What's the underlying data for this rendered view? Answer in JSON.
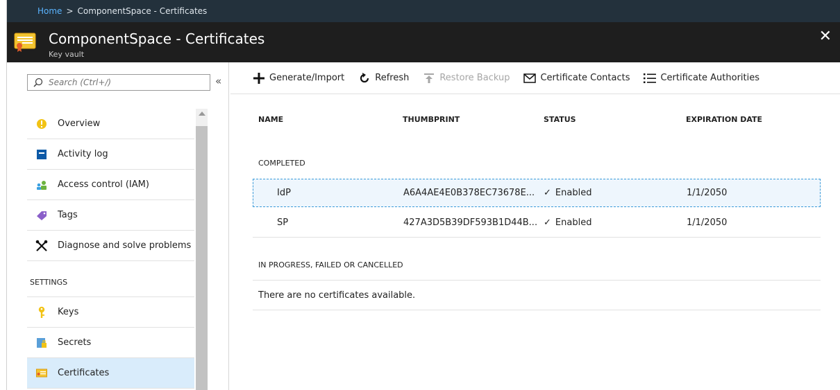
{
  "breadcrumb": {
    "home": "Home",
    "separator": ">",
    "current": "ComponentSpace - Certificates"
  },
  "header": {
    "title": "ComponentSpace - Certificates",
    "subtitle": "Key vault",
    "close": "✕"
  },
  "sidebar": {
    "search_placeholder": "Search (Ctrl+/)",
    "collapse": "«",
    "items": [
      {
        "label": "Overview",
        "icon": "overview-icon"
      },
      {
        "label": "Activity log",
        "icon": "activity-log-icon"
      },
      {
        "label": "Access control (IAM)",
        "icon": "users-icon"
      },
      {
        "label": "Tags",
        "icon": "tag-icon"
      },
      {
        "label": "Diagnose and solve problems",
        "icon": "wrench-icon"
      }
    ],
    "section": "SETTINGS",
    "settings_items": [
      {
        "label": "Keys",
        "icon": "key-icon"
      },
      {
        "label": "Secrets",
        "icon": "secret-icon"
      },
      {
        "label": "Certificates",
        "icon": "certificate-icon",
        "active": true
      }
    ]
  },
  "toolbar": {
    "generate": "Generate/Import",
    "refresh": "Refresh",
    "restore": "Restore Backup",
    "contacts": "Certificate Contacts",
    "authorities": "Certificate Authorities"
  },
  "table": {
    "columns": {
      "name": "NAME",
      "thumbprint": "THUMBPRINT",
      "status": "STATUS",
      "expiration": "EXPIRATION DATE"
    },
    "completed_label": "COMPLETED",
    "rows": [
      {
        "name": "IdP",
        "thumbprint": "A6A4AE4E0B378EC73678E...",
        "status": "Enabled",
        "expiration": "1/1/2050"
      },
      {
        "name": "SP",
        "thumbprint": "427A3D5B39DF593B1D44B...",
        "status": "Enabled",
        "expiration": "1/1/2050"
      }
    ],
    "pending_label": "IN PROGRESS, FAILED OR CANCELLED",
    "empty_message": "There are no certificates available.",
    "check_mark": "✓"
  },
  "colors": {
    "accent": "#0078d4",
    "header_bg": "#1e1e1e",
    "breadcrumb_bg": "#23313c",
    "active_bg": "#d9ecfb"
  }
}
